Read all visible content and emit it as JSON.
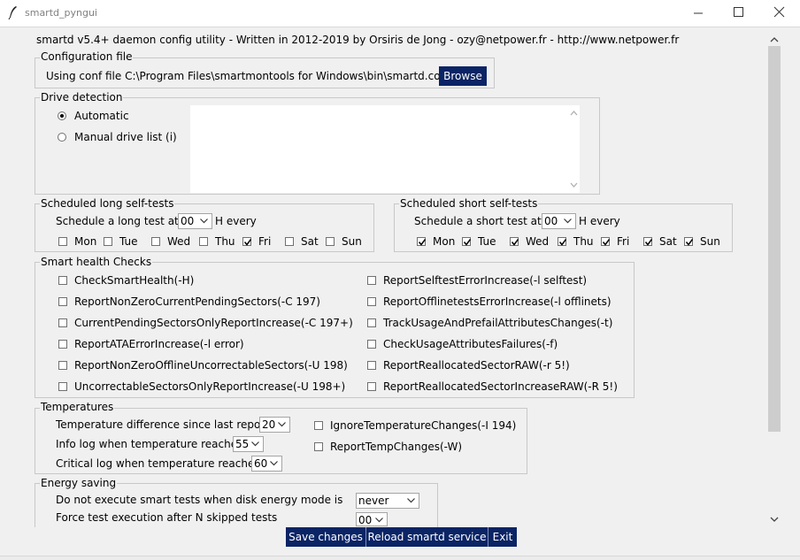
{
  "window": {
    "title": "smartd_pyngui"
  },
  "header": {
    "text": "smartd v5.4+ daemon config utility - Written in 2012-2019 by Orsiris de Jong - ozy@netpower.fr - http://www.netpower.fr"
  },
  "config_file": {
    "frame_title": "Configuration file",
    "label": "Using conf file C:\\Program Files\\smartmontools for Windows\\bin\\smartd.conf",
    "browse_label": "Browse"
  },
  "drive_detection": {
    "frame_title": "Drive detection",
    "automatic_label": "Automatic",
    "manual_label": "Manual drive list (i)",
    "selected": "Automatic"
  },
  "long_tests": {
    "frame_title": "Scheduled long self-tests",
    "schedule_label": "Schedule a long test at",
    "hour": "00",
    "every_label": "H every",
    "days": [
      {
        "label": "Mon",
        "checked": false
      },
      {
        "label": "Tue",
        "checked": false
      },
      {
        "label": "Wed",
        "checked": false
      },
      {
        "label": "Thu",
        "checked": false
      },
      {
        "label": "Fri",
        "checked": true
      },
      {
        "label": "Sat",
        "checked": false
      },
      {
        "label": "Sun",
        "checked": false
      }
    ]
  },
  "short_tests": {
    "frame_title": "Scheduled short self-tests",
    "schedule_label": "Schedule a short test at",
    "hour": "00",
    "every_label": "H every",
    "days": [
      {
        "label": "Mon",
        "checked": true
      },
      {
        "label": "Tue",
        "checked": true
      },
      {
        "label": "Wed",
        "checked": true
      },
      {
        "label": "Thu",
        "checked": true
      },
      {
        "label": "Fri",
        "checked": true
      },
      {
        "label": "Sat",
        "checked": true
      },
      {
        "label": "Sun",
        "checked": true
      }
    ]
  },
  "health": {
    "frame_title": "Smart health Checks",
    "left": [
      {
        "label": "CheckSmartHealth(-H)",
        "checked": false
      },
      {
        "label": "ReportNonZeroCurrentPendingSectors(-C 197)",
        "checked": false
      },
      {
        "label": "CurrentPendingSectorsOnlyReportIncrease(-C 197+)",
        "checked": false
      },
      {
        "label": "ReportATAErrorIncrease(-l error)",
        "checked": false
      },
      {
        "label": "ReportNonZeroOfflineUncorrectableSectors(-U 198)",
        "checked": false
      },
      {
        "label": "UncorrectableSectorsOnlyReportIncrease(-U 198+)",
        "checked": false
      }
    ],
    "right": [
      {
        "label": "ReportSelftestErrorIncrease(-l selftest)",
        "checked": false
      },
      {
        "label": "ReportOfflinetestsErrorIncrease(-l offlinets)",
        "checked": false
      },
      {
        "label": "TrackUsageAndPrefailAttributesChanges(-t)",
        "checked": false
      },
      {
        "label": "CheckUsageAttributesFailures(-f)",
        "checked": false
      },
      {
        "label": "ReportReallocatedSectorRAW(-r 5!)",
        "checked": false
      },
      {
        "label": "ReportReallocatedSectorIncreaseRAW(-R 5!)",
        "checked": false
      }
    ]
  },
  "temperatures": {
    "frame_title": "Temperatures",
    "diff_label": "Temperature difference since last report",
    "diff_value": "20",
    "info_label": "Info log when temperature reached",
    "info_value": "55",
    "critical_label": "Critical log when temperature reached",
    "critical_value": "60",
    "ignore_label": "IgnoreTemperatureChanges(-I 194)",
    "ignore_checked": false,
    "report_label": "ReportTempChanges(-W)",
    "report_checked": false
  },
  "energy": {
    "frame_title": "Energy saving",
    "mode_label": "Do not execute smart tests when disk energy mode is",
    "mode_value": "never",
    "force_label": "Force test execution after N skipped tests",
    "force_value": "00"
  },
  "actions": {
    "save_label": "Save changes",
    "reload_label": "Reload smartd service",
    "exit_label": "Exit"
  }
}
